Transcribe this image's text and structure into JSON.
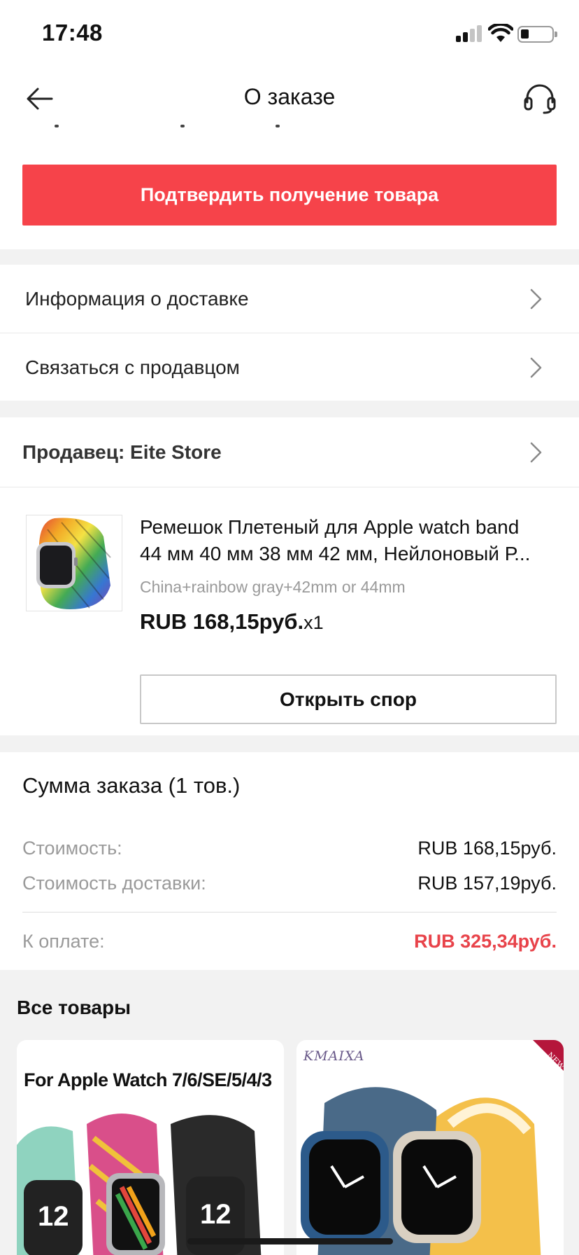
{
  "status_bar": {
    "time": "17:48"
  },
  "nav": {
    "title": "О заказе"
  },
  "actions": {
    "confirm_label": "Подтвердить получение товара"
  },
  "rows": {
    "delivery_info": "Информация о доставке",
    "contact_seller": "Связаться с продавцом"
  },
  "seller": {
    "label": "Продавец: Eite Store"
  },
  "product": {
    "title_line1": "Ремешок Плетеный для Apple watch band",
    "title_line2": "44 мм 40 мм 38 мм 42 мм, Нейлоновый Р...",
    "variant": "China+rainbow gray+42mm or 44mm",
    "price": "RUB 168,15руб.",
    "qty": "x1",
    "dispute_label": "Открыть спор"
  },
  "summary": {
    "title": "Сумма заказа (1 тов.)",
    "cost_label": "Стоимость:",
    "cost_value": "RUB 168,15руб.",
    "shipping_label": "Стоимость доставки:",
    "shipping_value": "RUB 157,19руб.",
    "total_label": "К оплате:",
    "total_value": "RUB 325,34руб.",
    "total_color": "#e8434a"
  },
  "recommendations": {
    "title": "Все товары",
    "cards": [
      {
        "caption": "For Apple Watch 7/6/SE/5/4/3"
      },
      {
        "brand": "KMAIXA",
        "ribbon": "NEW COLORS"
      }
    ]
  },
  "colors": {
    "accent": "#f6434a",
    "gap": "#f2f2f2"
  }
}
